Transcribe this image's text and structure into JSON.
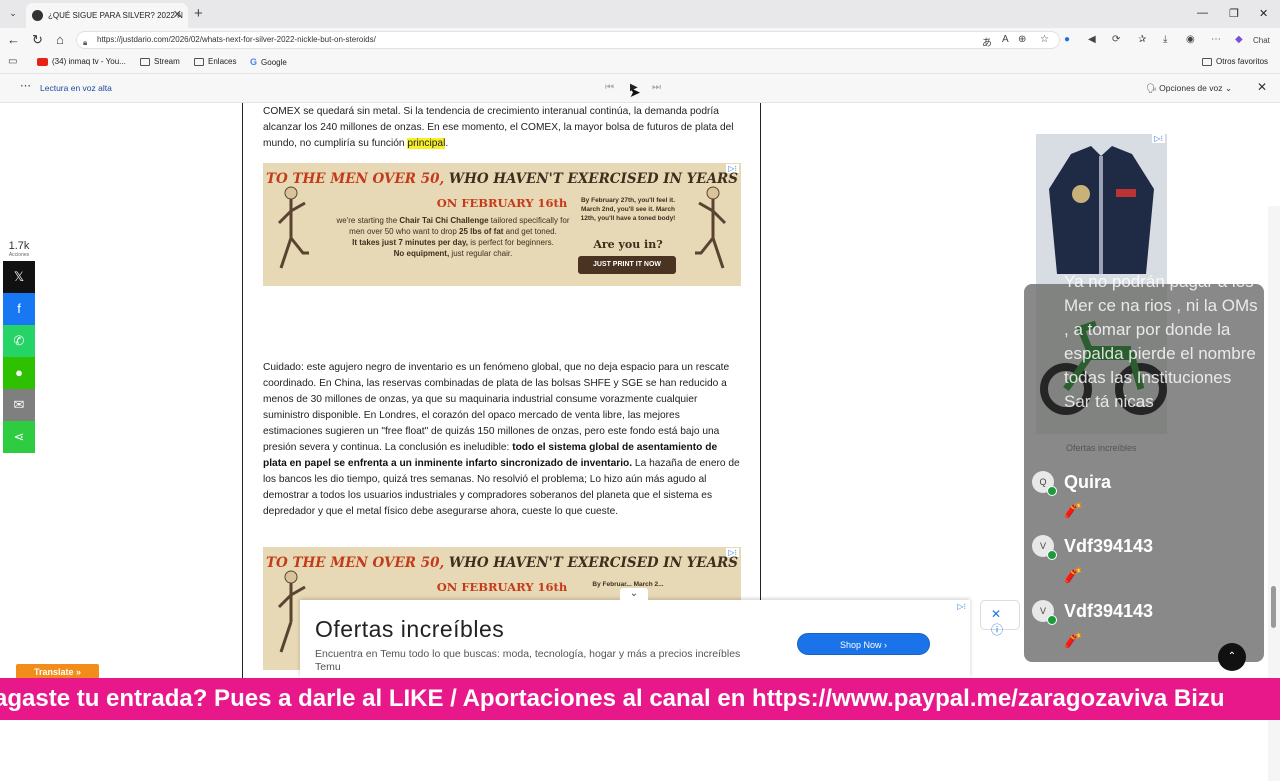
{
  "browser": {
    "tab_title": "¿QUÉ SIGUE PARA SILVER? 2022 N",
    "url": "https://justdario.com/2026/02/whats-next-for-silver-2022-nickle-but-on-steroids/",
    "chat_label": "Chat",
    "bookmarks": [
      "(34) inmaq tv - You...",
      "Stream",
      "Enlaces",
      "Google"
    ],
    "other_favorites": "Otros favoritos",
    "read_aloud": "Lectura en voz alta",
    "voice_options": "Opciones de voz"
  },
  "share": {
    "count": "1.7k",
    "count_label": "Acciones",
    "buttons": [
      {
        "name": "x",
        "glyph": "𝕏",
        "color": "#111111"
      },
      {
        "name": "facebook",
        "glyph": "f",
        "color": "#1877f2"
      },
      {
        "name": "whatsapp",
        "glyph": "✆",
        "color": "#25d366"
      },
      {
        "name": "wechat",
        "glyph": "●",
        "color": "#2dc100"
      },
      {
        "name": "email",
        "glyph": "✉",
        "color": "#7f7f7f"
      },
      {
        "name": "share",
        "glyph": "⋖",
        "color": "#2ecc40"
      }
    ]
  },
  "article": {
    "p1_before": "COMEX se quedará sin metal. Si la tendencia de crecimiento interanual continúa, la demanda podría alcanzar los 240 millones de onzas. En ese momento, el COMEX, la mayor bolsa de futuros de plata del mundo, no cumpliría su función ",
    "p1_highlight": "principal",
    "p1_after": ".",
    "p2_before": "Cuidado: este agujero negro de inventario es un fenómeno global, que no deja espacio para un rescate coordinado. En China, las reservas combinadas de plata de las bolsas SHFE y SGE se han reducido a menos de 30 millones de onzas, ya que su maquinaria industrial consume vorazmente cualquier suministro disponible. En Londres, el corazón del opaco mercado de venta libre, las mejores estimaciones sugieren un \"free float\" de quizás 150 millones de onzas, pero este fondo está bajo una presión severa y continua. La conclusión es ineludible: ",
    "p2_bold": "todo el sistema global de asentamiento de plata en papel se enfrenta a un inminente infarto sincronizado de inventario.",
    "p2_after": " La hazaña de enero de los bancos les dio tiempo, quizá tres semanas. No resolvió el problema; Lo hizo aún más agudo al demostrar a todos los usuarios industriales y compradores soberanos del planeta que el sistema es depredador y que el metal físico debe asegurarse ahora, cueste lo que cueste."
  },
  "ad_tai_chi": {
    "headline_accent": "TO THE MEN OVER 50,",
    "headline_rest": " WHO HAVEN'T EXERCISED IN YEARS",
    "date": "ON FEBRUARY 16th",
    "copy_1": "we're starting the ",
    "copy_bold": "Chair Tai Chi Challenge",
    "copy_2": " tailored specifically for men over 50 who want to drop ",
    "copy_bold2": "25 lbs of fat",
    "copy_3": " and get toned.",
    "copy_bold3": "It takes just 7 minutes per day,",
    "copy_4": " is perfect for beginners.",
    "copy_bold4": "No equipment,",
    "copy_5": " just regular chair.",
    "timeline": "By February 27th, you'll feel it. March 2nd, you'll see it. March 12th, you'll have a toned body!",
    "timeline_short": "By Februar... March 2...",
    "question": "Are you in?",
    "cta": "JUST PRINT IT NOW",
    "adchoice": "▷⁝"
  },
  "chat": {
    "message": "Ya no podrán pagar a los Mer ce na rios , ni la OMs , a tomar por donde la espalda pierde el nombre todas las Instituciones Sar tá nicas",
    "users": [
      {
        "initial": "Q",
        "name": "Quira",
        "emoji": "🧨"
      },
      {
        "initial": "V",
        "name": "Vdf394143",
        "emoji": "🧨"
      },
      {
        "initial": "V",
        "name": "Vdf394143",
        "emoji": "🧨"
      }
    ],
    "faded_label": "Ofertas increíbles"
  },
  "temu": {
    "title": "Ofertas increíbles",
    "description": "Encuentra en Temu todo lo que buscas: moda, tecnología, hogar y más a precios increíbles Temu",
    "shop_label": "Shop Now  ›"
  },
  "translate": "Translate »",
  "ticker": "agaste tu entrada? Pues a darle al LIKE / Aportaciones al canal en https://www.paypal.me/zaragozaviva Bizu"
}
